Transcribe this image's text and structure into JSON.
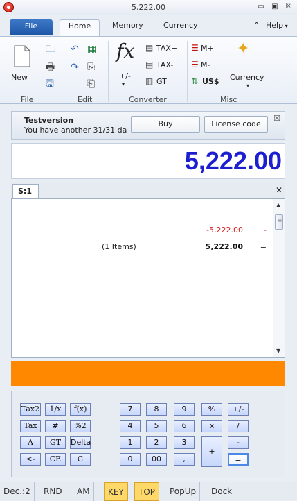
{
  "window": {
    "title": "5,222.00"
  },
  "icons": {
    "app": "app-logo-icon",
    "minimize": "minimize-icon",
    "maximize": "maximize-icon",
    "close": "close-icon"
  },
  "tabs": {
    "file": "File",
    "home": "Home",
    "memory": "Memory",
    "currency": "Currency",
    "collapse": "^",
    "help": "Help"
  },
  "ribbon": {
    "groups": {
      "file": "File",
      "edit": "Edit",
      "converter": "Converter",
      "misc": "Misc"
    },
    "new": "New",
    "fx": "fx",
    "plus_minus": "+/-",
    "tax_plus": "TAX+",
    "tax_minus": "TAX-",
    "gt": "GT",
    "m_plus": "M+",
    "m_minus": "M-",
    "uss": "US$",
    "currency": "Currency"
  },
  "notice": {
    "title": "Testversion",
    "message": "You have another 31/31 da",
    "buy": "Buy",
    "license": "License code"
  },
  "display": {
    "value": "5,222.00"
  },
  "tape": {
    "tab": "S:1",
    "lines": [
      {
        "label": "",
        "amount": "-5,222.00",
        "op": "-",
        "color": "#d11f1f"
      },
      {
        "label": "(1 Items)",
        "amount": "5,222.00",
        "op": "=",
        "color": "#111111"
      }
    ]
  },
  "keypad": {
    "left": [
      [
        "Tax2",
        "1/x",
        "f(x)"
      ],
      [
        "Tax",
        "#",
        "%2"
      ],
      [
        "A",
        "GT",
        "Delta"
      ],
      [
        "<-",
        "CE",
        "C"
      ]
    ],
    "numbers": [
      [
        "7",
        "8",
        "9",
        "%",
        "+/-"
      ],
      [
        "4",
        "5",
        "6",
        "x",
        "/"
      ],
      [
        "1",
        "2",
        "3",
        "+",
        "-"
      ],
      [
        "0",
        "00",
        ",",
        "",
        "="
      ]
    ]
  },
  "status": {
    "dec": "Dec.:2",
    "rnd": "RND",
    "am": "AM",
    "key": "KEY",
    "top": "TOP",
    "popup": "PopUp",
    "dock": "Dock"
  }
}
